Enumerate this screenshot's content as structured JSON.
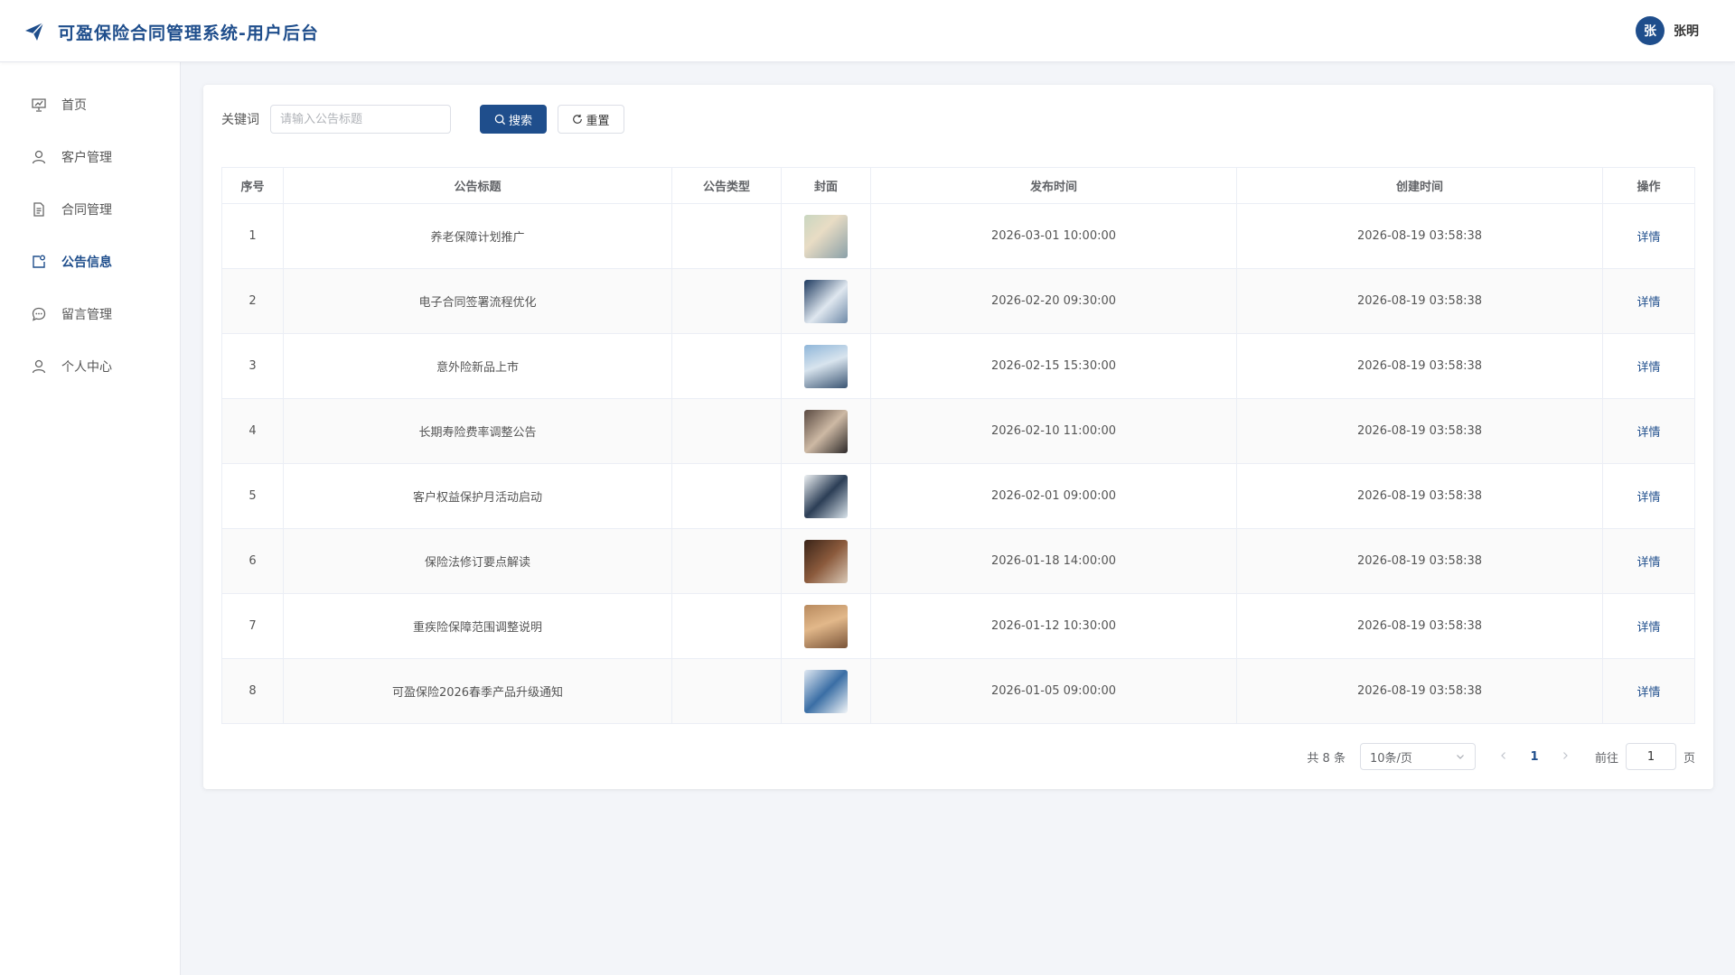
{
  "app": {
    "title": "可盈保险合同管理系统-用户后台",
    "logo_icon": "paper-plane-icon"
  },
  "user": {
    "avatar_text": "张",
    "name": "张明"
  },
  "colors": {
    "brand": "#1f4e8c",
    "background": "#f3f5f9",
    "page_link": "#1f4e8c"
  },
  "sidebar": {
    "items": [
      {
        "label": "首页",
        "icon": "home-chart-icon",
        "active": false
      },
      {
        "label": "客户管理",
        "icon": "user-icon",
        "active": false
      },
      {
        "label": "合同管理",
        "icon": "document-icon",
        "active": false
      },
      {
        "label": "公告信息",
        "icon": "notice-icon",
        "active": true
      },
      {
        "label": "留言管理",
        "icon": "chat-icon",
        "active": false
      },
      {
        "label": "个人中心",
        "icon": "user-icon",
        "active": false
      }
    ]
  },
  "search": {
    "label": "关键词",
    "placeholder": "请输入公告标题",
    "value": "",
    "search_label": "搜索",
    "reset_label": "重置"
  },
  "table": {
    "headers": [
      "序号",
      "公告标题",
      "公告类型",
      "封面",
      "发布时间",
      "创建时间",
      "操作"
    ],
    "rows": [
      {
        "index": "1",
        "title": "养老保障计划推广",
        "type": "",
        "cover": "elderly-couple-photo",
        "publish_time": "2026-03-01 10:00:00",
        "create_time": "2026-08-19 03:58:38",
        "action": "详情"
      },
      {
        "index": "2",
        "title": "电子合同签署流程优化",
        "type": "",
        "cover": "laptop-contract-photo",
        "publish_time": "2026-02-20 09:30:00",
        "create_time": "2026-08-19 03:58:38",
        "action": "详情"
      },
      {
        "index": "3",
        "title": "意外险新品上市",
        "type": "",
        "cover": "man-city-photo",
        "publish_time": "2026-02-15 15:30:00",
        "create_time": "2026-08-19 03:58:38",
        "action": "详情"
      },
      {
        "index": "4",
        "title": "长期寿险费率调整公告",
        "type": "",
        "cover": "senior-meeting-photo",
        "publish_time": "2026-02-10 11:00:00",
        "create_time": "2026-08-19 03:58:38",
        "action": "详情"
      },
      {
        "index": "5",
        "title": "客户权益保护月活动启动",
        "type": "",
        "cover": "consultation-photo",
        "publish_time": "2026-02-01 09:00:00",
        "create_time": "2026-08-19 03:58:38",
        "action": "详情"
      },
      {
        "index": "6",
        "title": "保险法修订要点解读",
        "type": "",
        "cover": "law-gavel-photo",
        "publish_time": "2026-01-18 14:00:00",
        "create_time": "2026-08-19 03:58:38",
        "action": "详情"
      },
      {
        "index": "7",
        "title": "重疾险保障范围调整说明",
        "type": "",
        "cover": "family-roof-photo",
        "publish_time": "2026-01-12 10:30:00",
        "create_time": "2026-08-19 03:58:38",
        "action": "详情"
      },
      {
        "index": "8",
        "title": "可盈保险2026春季产品升级通知",
        "type": "",
        "cover": "product-screen-photo",
        "publish_time": "2026-01-05 09:00:00",
        "create_time": "2026-08-19 03:58:38",
        "action": "详情"
      }
    ]
  },
  "pagination": {
    "total_text": "共 8 条",
    "page_size": "10条/页",
    "current_page": "1",
    "goto_label": "前往",
    "goto_value": "1",
    "page_suffix": "页"
  }
}
